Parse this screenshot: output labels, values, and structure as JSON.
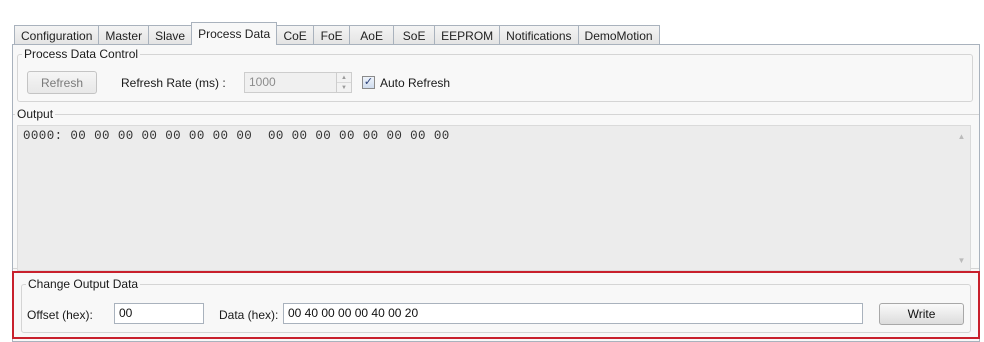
{
  "tabs": [
    {
      "label": "Configuration",
      "active": false
    },
    {
      "label": "Master",
      "active": false
    },
    {
      "label": "Slave",
      "active": false
    },
    {
      "label": "Process Data",
      "active": true
    },
    {
      "label": "CoE",
      "active": false
    },
    {
      "label": "FoE",
      "active": false
    },
    {
      "label": "AoE",
      "active": false
    },
    {
      "label": "SoE",
      "active": false
    },
    {
      "label": "EEPROM",
      "active": false
    },
    {
      "label": "Notifications",
      "active": false
    },
    {
      "label": "DemoMotion",
      "active": false
    }
  ],
  "process_data_control": {
    "title": "Process Data Control",
    "refresh_button": "Refresh",
    "refresh_rate_label": "Refresh Rate (ms) :",
    "refresh_rate_value": "1000",
    "auto_refresh_label": "Auto Refresh",
    "auto_refresh_checked": true
  },
  "output": {
    "title": "Output",
    "text": "0000: 00 00 00 00 00 00 00 00  00 00 00 00 00 00 00 00"
  },
  "change_output_data": {
    "title": "Change Output Data",
    "offset_label": "Offset (hex):",
    "offset_value": "00",
    "data_label": "Data (hex):",
    "data_value": "00 40 00 00 00 40 00 20",
    "write_button": "Write"
  },
  "icons": {
    "spin_up": "▲",
    "spin_down": "▼",
    "check": "✓",
    "scroll_up": "▲",
    "scroll_down": "▼"
  },
  "colors": {
    "highlight_border": "#c8202c"
  }
}
